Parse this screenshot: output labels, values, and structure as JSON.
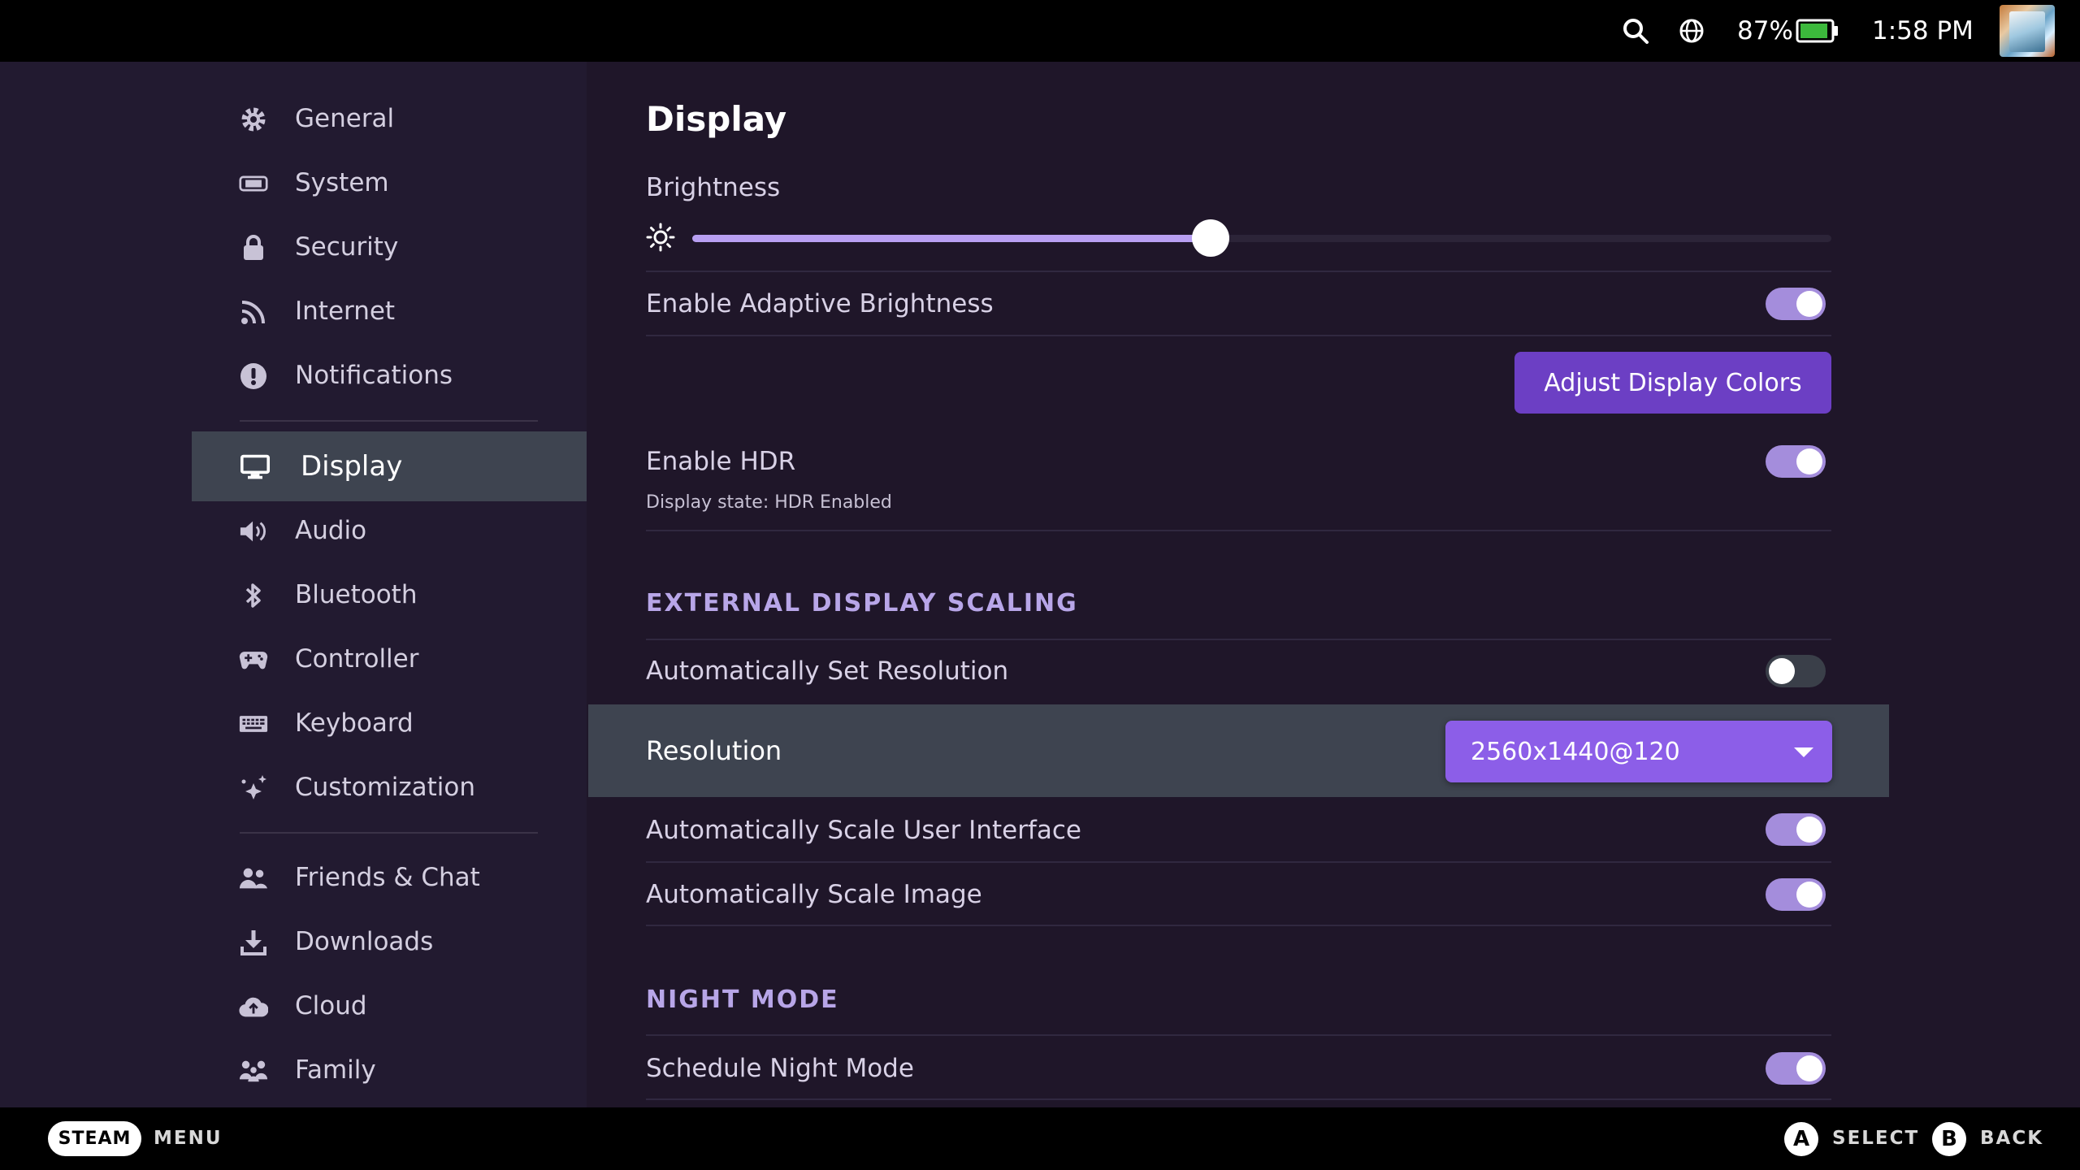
{
  "status": {
    "battery": "87%",
    "time": "1:58 PM"
  },
  "sidebar": {
    "items": [
      {
        "label": "General",
        "icon": "gear-icon"
      },
      {
        "label": "System",
        "icon": "system-icon"
      },
      {
        "label": "Security",
        "icon": "lock-icon"
      },
      {
        "label": "Internet",
        "icon": "wifi-icon"
      },
      {
        "label": "Notifications",
        "icon": "alert-icon"
      },
      {
        "label": "Display",
        "icon": "monitor-icon"
      },
      {
        "label": "Audio",
        "icon": "speaker-icon"
      },
      {
        "label": "Bluetooth",
        "icon": "bluetooth-icon"
      },
      {
        "label": "Controller",
        "icon": "gamepad-icon"
      },
      {
        "label": "Keyboard",
        "icon": "keyboard-icon"
      },
      {
        "label": "Customization",
        "icon": "sparkle-icon"
      },
      {
        "label": "Friends & Chat",
        "icon": "friends-icon"
      },
      {
        "label": "Downloads",
        "icon": "download-icon"
      },
      {
        "label": "Cloud",
        "icon": "cloud-icon"
      },
      {
        "label": "Family",
        "icon": "family-icon"
      }
    ],
    "active": "Display"
  },
  "main": {
    "title": "Display",
    "brightness_label": "Brightness",
    "brightness_level": 0.455,
    "adaptive_label": "Enable Adaptive Brightness",
    "adaptive_on": true,
    "adjust_colors_label": "Adjust Display Colors",
    "hdr_label": "Enable HDR",
    "hdr_on": true,
    "hdr_state": "Display state: HDR Enabled",
    "external_section": "EXTERNAL DISPLAY SCALING",
    "auto_res_label": "Automatically Set Resolution",
    "auto_res_on": false,
    "resolution_label": "Resolution",
    "resolution_value": "2560x1440@120",
    "auto_ui_label": "Automatically Scale User Interface",
    "auto_ui_on": true,
    "auto_image_label": "Automatically Scale Image",
    "auto_image_on": true,
    "night_section": "NIGHT MODE",
    "schedule_night_label": "Schedule Night Mode",
    "schedule_night_on": true
  },
  "footer": {
    "steam": "STEAM",
    "menu": "MENU",
    "a_glyph": "A",
    "select": "SELECT",
    "b_glyph": "B",
    "back": "BACK"
  },
  "colors": {
    "accent": "#8c5ee8",
    "toggle_on": "#a48ddc",
    "slider_fill": "#b89ff2",
    "button": "#6c3fc4"
  }
}
